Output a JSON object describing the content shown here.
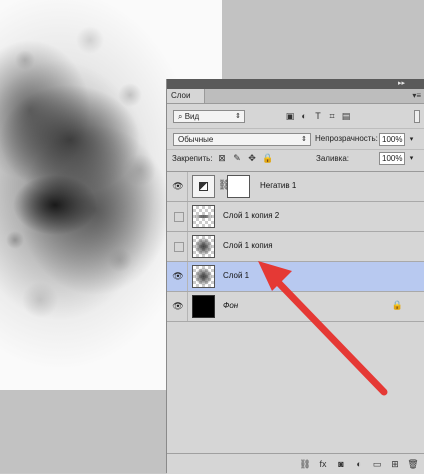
{
  "panel": {
    "tab_label": "Слои",
    "collapse_glyph": "▸▸",
    "close_glyph": "▾≡",
    "menu_glyph": "▾≡",
    "filter": {
      "value": "Вид",
      "search_glyph": "⌕",
      "arrows": "⇕"
    },
    "filter_icons": [
      "▣",
      "◐",
      "T",
      "⌗",
      "▤"
    ],
    "blend_mode": {
      "value": "Обычные",
      "arrows": "⇕"
    },
    "opacity": {
      "label": "Непрозрачность:",
      "value": "100%",
      "arrow": "▾"
    },
    "lock": {
      "label": "Закрепить:",
      "icons": [
        "⊠",
        "✎",
        "✥",
        "🔒"
      ]
    },
    "fill": {
      "label": "Заливка:",
      "value": "100%",
      "arrow": "▾"
    },
    "layers": [
      {
        "name": "Негатив 1",
        "visible": true,
        "type": "adjustment",
        "selected": false
      },
      {
        "name": "Слой 1 копия 2",
        "visible": false,
        "type": "pixel-line",
        "selected": false
      },
      {
        "name": "Слой 1 копия",
        "visible": false,
        "type": "pixel-cloud",
        "selected": false
      },
      {
        "name": "Слой 1",
        "visible": true,
        "type": "pixel-cloud",
        "selected": true
      },
      {
        "name": "Фон",
        "visible": true,
        "type": "background",
        "selected": false,
        "locked": true
      }
    ],
    "footer_icons": [
      "⛓",
      "fx",
      "◙",
      "◐",
      "▭",
      "⊞",
      "🗑"
    ]
  },
  "annotation": {
    "arrow_color": "#e53935"
  }
}
